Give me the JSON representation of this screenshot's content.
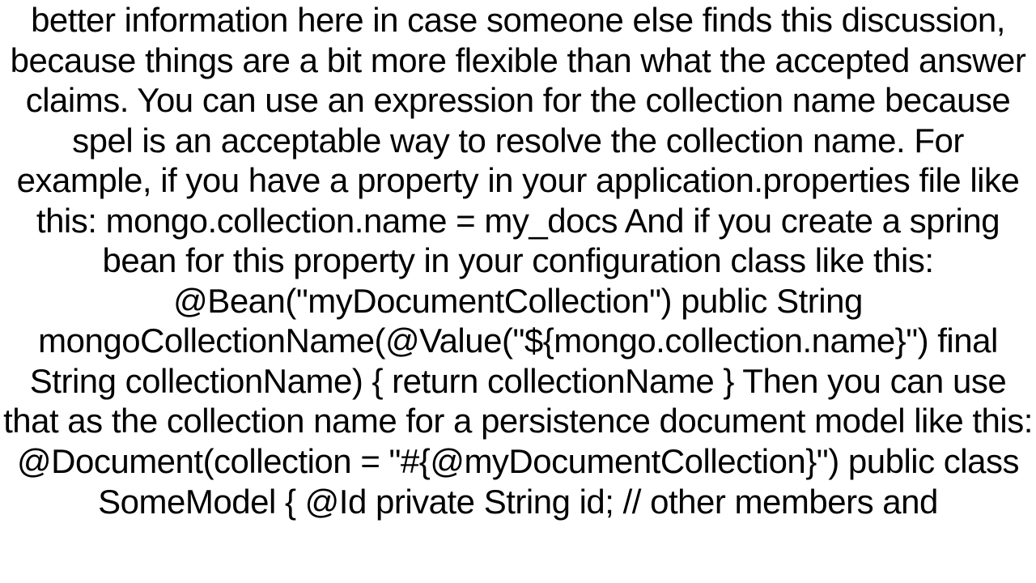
{
  "document": {
    "body_text": "better information here in case someone else finds this discussion, because things are a bit more flexible than what the accepted answer claims. You can use an expression for the collection name because spel is an acceptable way to resolve the collection name.  For example, if you have a property in your application.properties file like this: mongo.collection.name = my_docs  And if you create a spring bean for this property in your configuration class like this: @Bean(\"myDocumentCollection\") public String mongoCollectionName(@Value(\"${mongo.collection.name}\") final String collectionName) {     return collectionName }  Then you can use that as the collection name for a persistence document model like this: @Document(collection = \"#{@myDocumentCollection}\") public class SomeModel {     @Id     private String id;     // other members and"
  }
}
